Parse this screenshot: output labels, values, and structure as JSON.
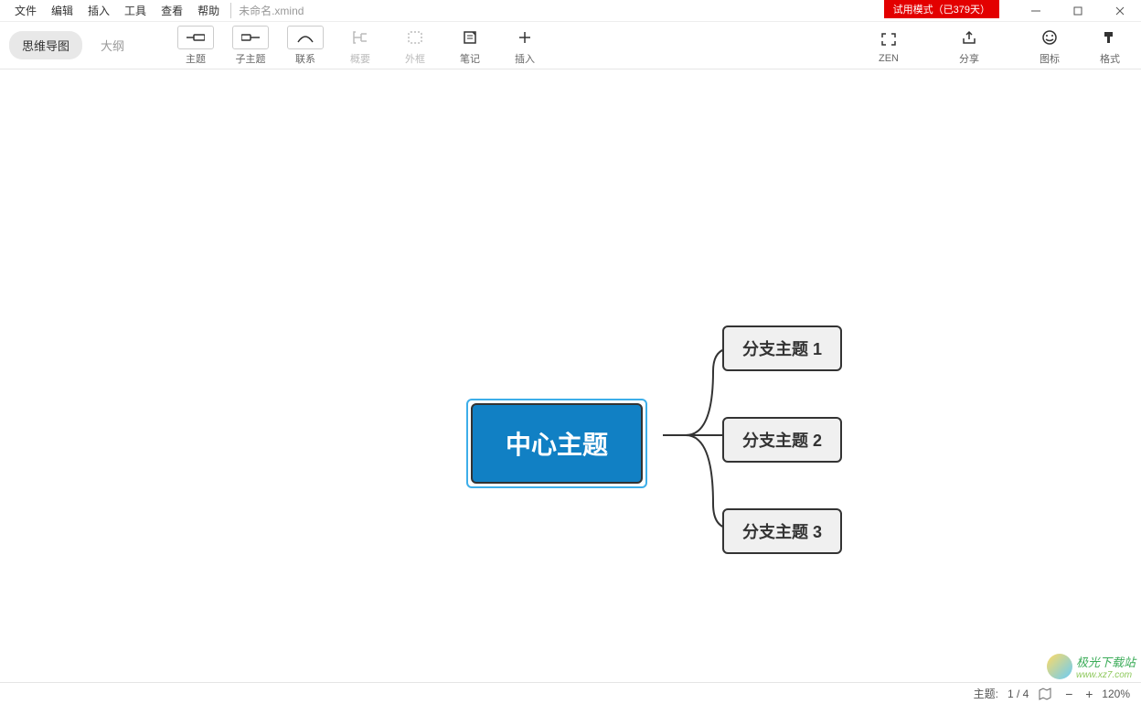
{
  "menubar": {
    "file": "文件",
    "edit": "编辑",
    "insert": "插入",
    "tools": "工具",
    "view": "查看",
    "help": "帮助"
  },
  "filename": "未命名.xmind",
  "trial_badge": "试用模式（已379天）",
  "view_tabs": {
    "mindmap": "思维导图",
    "outline": "大纲"
  },
  "toolbar": {
    "topic": "主题",
    "subtopic": "子主题",
    "relationship": "联系",
    "summary": "概要",
    "boundary": "外框",
    "notes": "笔记",
    "insert": "插入",
    "zen": "ZEN",
    "share": "分享",
    "icons": "图标",
    "format": "格式"
  },
  "mindmap": {
    "central": "中心主题",
    "branch1": "分支主题 1",
    "branch2": "分支主题 2",
    "branch3": "分支主题 3"
  },
  "statusbar": {
    "topic_label": "主题:",
    "topic_count": "1 / 4",
    "zoom": "120%"
  },
  "watermark": {
    "title": "极光下载站",
    "url": "www.xz7.com"
  }
}
